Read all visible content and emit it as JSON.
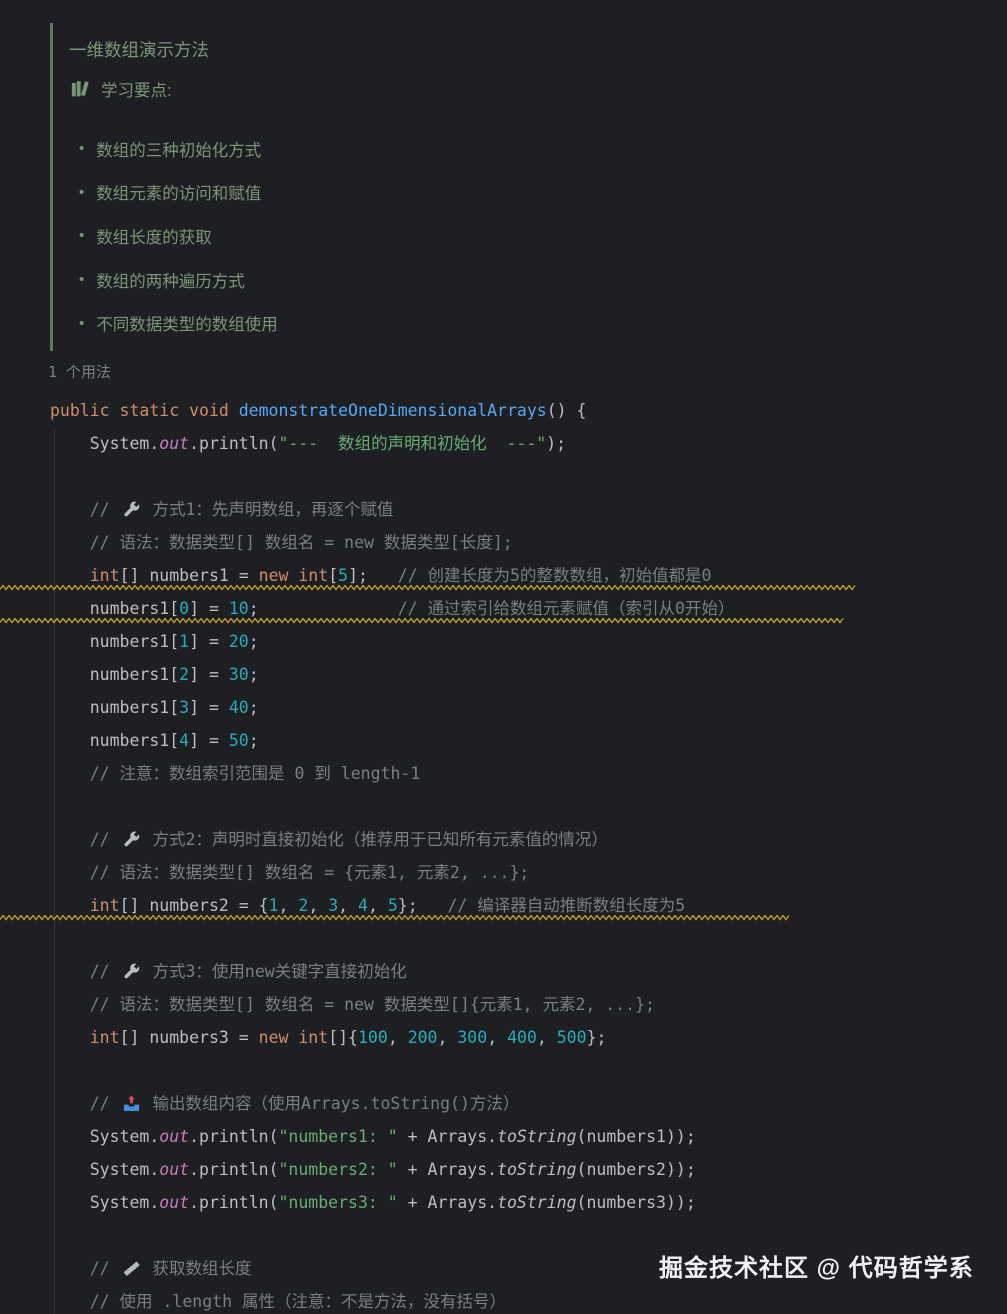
{
  "doc": {
    "title": "一维数组演示方法",
    "heading_icon": "books-icon",
    "heading": "学习要点:",
    "bullets": [
      "数组的三种初始化方式",
      "数组元素的访问和赋值",
      "数组长度的获取",
      "数组的两种遍历方式",
      "不同数据类型的数组使用"
    ]
  },
  "usages_label": "1 个用法",
  "watermark": "掘金技术社区 @ 代码哲学系",
  "colors": {
    "background": "#1e1f22",
    "keyword": "#cf8e6d",
    "method_decl": "#56a8f5",
    "string": "#6aab73",
    "number": "#2aacb8",
    "comment": "#7a7e85",
    "field": "#c77dbb",
    "default_text": "#bcbec4",
    "doc_text": "#7c9579",
    "doc_border": "#5c7a5b",
    "warning_squiggle": "#bfa32b",
    "usages_hint": "#7c8087",
    "watermark_text": "#f1f1f3"
  },
  "code": {
    "lines": [
      {
        "tokens": [
          {
            "t": "public static void ",
            "c": "kw"
          },
          {
            "t": "demonstrateOneDimensionalArrays",
            "c": "fn"
          },
          {
            "t": "() {",
            "c": "p"
          }
        ]
      },
      {
        "tokens": [
          {
            "t": "    System.",
            "c": "p"
          },
          {
            "t": "out",
            "c": "fld"
          },
          {
            "t": ".println(",
            "c": "p"
          },
          {
            "t": "\"---  数组的声明和初始化  ---\"",
            "c": "str"
          },
          {
            "t": ");",
            "c": "p"
          }
        ]
      },
      {
        "tokens": []
      },
      {
        "tokens": [
          {
            "t": "    ",
            "c": "p"
          },
          {
            "t": "// ",
            "c": "cmt"
          },
          {
            "icon": "wrench-icon"
          },
          {
            "t": " 方式1：先声明数组，再逐个赋值",
            "c": "cmt"
          }
        ]
      },
      {
        "tokens": [
          {
            "t": "    ",
            "c": "p"
          },
          {
            "t": "// 语法：数据类型[] 数组名 = new 数据类型[长度];",
            "c": "cmt"
          }
        ]
      },
      {
        "tokens": [
          {
            "t": "    ",
            "c": "p"
          },
          {
            "t": "int",
            "c": "kw"
          },
          {
            "t": "[] numbers1 = ",
            "c": "p"
          },
          {
            "t": "new int",
            "c": "kw"
          },
          {
            "t": "[",
            "c": "p"
          },
          {
            "t": "5",
            "c": "num"
          },
          {
            "t": "];",
            "c": "p"
          },
          {
            "t": "   ",
            "c": "p"
          },
          {
            "t": "// 创建长度为5的整数数组，初始值都是0",
            "c": "cmt"
          }
        ],
        "squiggle": 856
      },
      {
        "tokens": [
          {
            "t": "    numbers1[",
            "c": "p"
          },
          {
            "t": "0",
            "c": "num"
          },
          {
            "t": "] = ",
            "c": "p"
          },
          {
            "t": "10",
            "c": "num"
          },
          {
            "t": ";",
            "c": "p"
          },
          {
            "t": "              ",
            "c": "p"
          },
          {
            "t": "// 通过索引给数组元素赋值（索引从0开始）",
            "c": "cmt"
          }
        ],
        "squiggle": 844
      },
      {
        "tokens": [
          {
            "t": "    numbers1[",
            "c": "p"
          },
          {
            "t": "1",
            "c": "num"
          },
          {
            "t": "] = ",
            "c": "p"
          },
          {
            "t": "20",
            "c": "num"
          },
          {
            "t": ";",
            "c": "p"
          }
        ]
      },
      {
        "tokens": [
          {
            "t": "    numbers1[",
            "c": "p"
          },
          {
            "t": "2",
            "c": "num"
          },
          {
            "t": "] = ",
            "c": "p"
          },
          {
            "t": "30",
            "c": "num"
          },
          {
            "t": ";",
            "c": "p"
          }
        ]
      },
      {
        "tokens": [
          {
            "t": "    numbers1[",
            "c": "p"
          },
          {
            "t": "3",
            "c": "num"
          },
          {
            "t": "] = ",
            "c": "p"
          },
          {
            "t": "40",
            "c": "num"
          },
          {
            "t": ";",
            "c": "p"
          }
        ]
      },
      {
        "tokens": [
          {
            "t": "    numbers1[",
            "c": "p"
          },
          {
            "t": "4",
            "c": "num"
          },
          {
            "t": "] = ",
            "c": "p"
          },
          {
            "t": "50",
            "c": "num"
          },
          {
            "t": ";",
            "c": "p"
          }
        ]
      },
      {
        "tokens": [
          {
            "t": "    ",
            "c": "p"
          },
          {
            "t": "// 注意：数组索引范围是 0 到 length-1",
            "c": "cmt"
          }
        ]
      },
      {
        "tokens": []
      },
      {
        "tokens": [
          {
            "t": "    ",
            "c": "p"
          },
          {
            "t": "// ",
            "c": "cmt"
          },
          {
            "icon": "wrench-icon"
          },
          {
            "t": " 方式2：声明时直接初始化（推荐用于已知所有元素值的情况）",
            "c": "cmt"
          }
        ]
      },
      {
        "tokens": [
          {
            "t": "    ",
            "c": "p"
          },
          {
            "t": "// 语法：数据类型[] 数组名 = {元素1, 元素2, ...};",
            "c": "cmt"
          }
        ]
      },
      {
        "tokens": [
          {
            "t": "    ",
            "c": "p"
          },
          {
            "t": "int",
            "c": "kw"
          },
          {
            "t": "[] numbers2 = {",
            "c": "p"
          },
          {
            "t": "1",
            "c": "num"
          },
          {
            "t": ", ",
            "c": "p"
          },
          {
            "t": "2",
            "c": "num"
          },
          {
            "t": ", ",
            "c": "p"
          },
          {
            "t": "3",
            "c": "num"
          },
          {
            "t": ", ",
            "c": "p"
          },
          {
            "t": "4",
            "c": "num"
          },
          {
            "t": ", ",
            "c": "p"
          },
          {
            "t": "5",
            "c": "num"
          },
          {
            "t": "};",
            "c": "p"
          },
          {
            "t": "   ",
            "c": "p"
          },
          {
            "t": "// 编译器自动推断数组长度为5",
            "c": "cmt"
          }
        ],
        "squiggle": 791
      },
      {
        "tokens": []
      },
      {
        "tokens": [
          {
            "t": "    ",
            "c": "p"
          },
          {
            "t": "// ",
            "c": "cmt"
          },
          {
            "icon": "wrench-icon"
          },
          {
            "t": " 方式3：使用new关键字直接初始化",
            "c": "cmt"
          }
        ]
      },
      {
        "tokens": [
          {
            "t": "    ",
            "c": "p"
          },
          {
            "t": "// 语法：数据类型[] 数组名 = new 数据类型[]{元素1, 元素2, ...};",
            "c": "cmt"
          }
        ]
      },
      {
        "tokens": [
          {
            "t": "    ",
            "c": "p"
          },
          {
            "t": "int",
            "c": "kw"
          },
          {
            "t": "[] numbers3 = ",
            "c": "p"
          },
          {
            "t": "new int",
            "c": "kw"
          },
          {
            "t": "[]{",
            "c": "p"
          },
          {
            "t": "100",
            "c": "num"
          },
          {
            "t": ", ",
            "c": "p"
          },
          {
            "t": "200",
            "c": "num"
          },
          {
            "t": ", ",
            "c": "p"
          },
          {
            "t": "300",
            "c": "num"
          },
          {
            "t": ", ",
            "c": "p"
          },
          {
            "t": "400",
            "c": "num"
          },
          {
            "t": ", ",
            "c": "p"
          },
          {
            "t": "500",
            "c": "num"
          },
          {
            "t": "};",
            "c": "p"
          }
        ]
      },
      {
        "tokens": []
      },
      {
        "tokens": [
          {
            "t": "    ",
            "c": "p"
          },
          {
            "t": "// ",
            "c": "cmt"
          },
          {
            "icon": "outbox-tray-icon"
          },
          {
            "t": " 输出数组内容（使用Arrays.toString()方法）",
            "c": "cmt"
          }
        ]
      },
      {
        "tokens": [
          {
            "t": "    System.",
            "c": "p"
          },
          {
            "t": "out",
            "c": "fld"
          },
          {
            "t": ".println(",
            "c": "p"
          },
          {
            "t": "\"numbers1: \"",
            "c": "str"
          },
          {
            "t": " + Arrays.",
            "c": "p"
          },
          {
            "t": "toString",
            "c": "ital"
          },
          {
            "t": "(numbers1));",
            "c": "p"
          }
        ]
      },
      {
        "tokens": [
          {
            "t": "    System.",
            "c": "p"
          },
          {
            "t": "out",
            "c": "fld"
          },
          {
            "t": ".println(",
            "c": "p"
          },
          {
            "t": "\"numbers2: \"",
            "c": "str"
          },
          {
            "t": " + Arrays.",
            "c": "p"
          },
          {
            "t": "toString",
            "c": "ital"
          },
          {
            "t": "(numbers2));",
            "c": "p"
          }
        ]
      },
      {
        "tokens": [
          {
            "t": "    System.",
            "c": "p"
          },
          {
            "t": "out",
            "c": "fld"
          },
          {
            "t": ".println(",
            "c": "p"
          },
          {
            "t": "\"numbers3: \"",
            "c": "str"
          },
          {
            "t": " + Arrays.",
            "c": "p"
          },
          {
            "t": "toString",
            "c": "ital"
          },
          {
            "t": "(numbers3));",
            "c": "p"
          }
        ]
      },
      {
        "tokens": []
      },
      {
        "tokens": [
          {
            "t": "    ",
            "c": "p"
          },
          {
            "t": "// ",
            "c": "cmt"
          },
          {
            "icon": "ruler-icon"
          },
          {
            "t": " 获取数组长度",
            "c": "cmt"
          }
        ]
      },
      {
        "tokens": [
          {
            "t": "    ",
            "c": "p"
          },
          {
            "t": "// 使用 .length 属性（注意：不是方法，没有括号）",
            "c": "cmt"
          }
        ]
      }
    ]
  }
}
